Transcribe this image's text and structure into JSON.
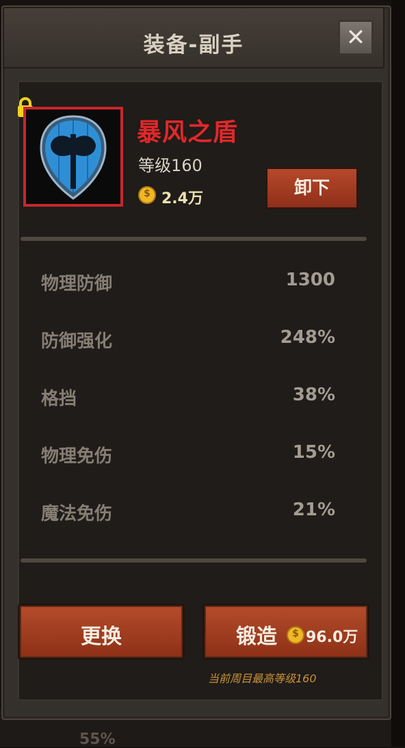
{
  "window": {
    "title": "装备-副手"
  },
  "item": {
    "name": "暴风之盾",
    "level": "等级160",
    "price": "2.4万",
    "unequip_label": "卸下",
    "locked": true
  },
  "stats": [
    {
      "label": "物理防御",
      "value": "1300"
    },
    {
      "label": "防御强化",
      "value": "248%"
    },
    {
      "label": "格挡",
      "value": "38%"
    },
    {
      "label": "物理免伤",
      "value": "15%"
    },
    {
      "label": "魔法免伤",
      "value": "21%"
    }
  ],
  "actions": {
    "replace_label": "更换",
    "forge_label": "锻造",
    "forge_cost": "96.0万",
    "note": "当前周目最高等级160"
  },
  "background": {
    "partial_text": "55%"
  },
  "colors": {
    "item_name": "#e0282a",
    "button": "#a63e22",
    "frame": "#c8262c",
    "shield": "#2f8fd6"
  }
}
